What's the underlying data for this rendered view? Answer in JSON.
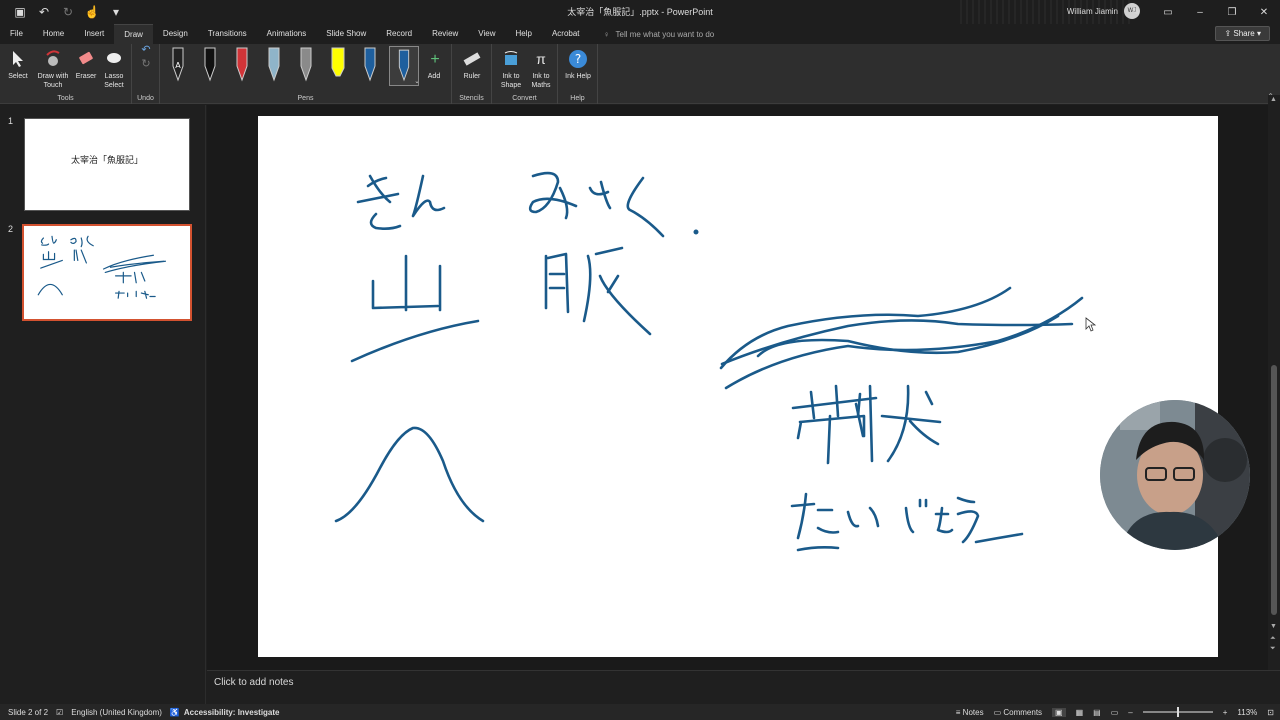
{
  "window": {
    "title": "太宰治「魚服記」.pptx  -  PowerPoint",
    "user_name": "William Jiamin",
    "user_initials": "WJ"
  },
  "tabs": [
    "File",
    "Home",
    "Insert",
    "Draw",
    "Design",
    "Transitions",
    "Animations",
    "Slide Show",
    "Record",
    "Review",
    "View",
    "Help",
    "Acrobat"
  ],
  "active_tab": "Draw",
  "tell_me": "Tell me what you want to do",
  "share_label": "Share",
  "ribbon": {
    "tools": {
      "select": "Select",
      "draw_touch": "Draw with Touch",
      "eraser": "Eraser",
      "lasso": "Lasso Select",
      "label": "Tools"
    },
    "undo_label": "Undo",
    "pens_label": "Pens",
    "add_label": "Add",
    "stencils": {
      "ruler": "Ruler",
      "label": "Stencils"
    },
    "convert": {
      "ink_shape": "Ink to Shape",
      "ink_math": "Ink to Maths",
      "label": "Convert"
    },
    "help": {
      "ink_help": "Ink Help",
      "label": "Help"
    },
    "pen_colors": [
      "#111111",
      "#111111",
      "#d13438",
      "#8a8a8a",
      "#8a8a8a",
      "#ffff00",
      "#1e5f9e",
      "#1e5f9e"
    ]
  },
  "slides": [
    {
      "number": "1",
      "title": "太宰治「魚服記」"
    },
    {
      "number": "2"
    }
  ],
  "notes_placeholder": "Click to add notes",
  "status": {
    "slide": "Slide 2 of 2",
    "language": "English (United Kingdom)",
    "accessibility": "Accessibility: Investigate",
    "notes": "Notes",
    "comments": "Comments",
    "zoom": "113%"
  },
  "ink_color": "#1a5a8a"
}
